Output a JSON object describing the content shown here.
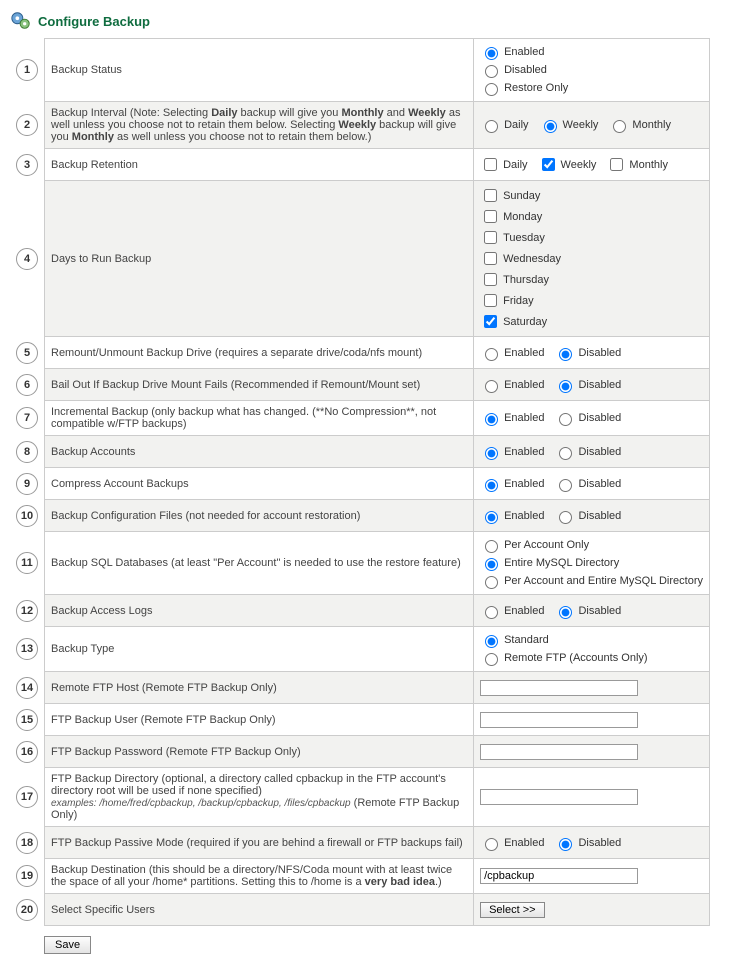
{
  "title": "Configure Backup",
  "save_label": "Save",
  "select_label": "Select >>",
  "rows": [
    {
      "num": "1",
      "label": "Backup Status",
      "type": "radio_col",
      "options": [
        "Enabled",
        "Disabled",
        "Restore Only"
      ],
      "checked": 0
    },
    {
      "num": "2",
      "label": "Backup Interval (Note: Selecting <b>Daily</b> backup will give you <b>Monthly</b> and <b>Weekly</b> as well unless you choose not to retain them below. Selecting <b>Weekly</b> backup will give you <b>Monthly</b> as well unless you choose not to retain them below.)",
      "type": "radio_row",
      "options": [
        "Daily",
        "Weekly",
        "Monthly"
      ],
      "checked": 1
    },
    {
      "num": "3",
      "label": "Backup Retention",
      "type": "check_row",
      "options": [
        "Daily",
        "Weekly",
        "Monthly"
      ],
      "checked": [
        1
      ]
    },
    {
      "num": "4",
      "label": "Days to Run Backup",
      "type": "check_col",
      "options": [
        "Sunday",
        "Monday",
        "Tuesday",
        "Wednesday",
        "Thursday",
        "Friday",
        "Saturday"
      ],
      "checked": [
        6
      ]
    },
    {
      "num": "5",
      "label": "Remount/Unmount Backup Drive (requires a separate drive/coda/nfs mount)",
      "type": "radio_row",
      "options": [
        "Enabled",
        "Disabled"
      ],
      "checked": 1
    },
    {
      "num": "6",
      "label": "Bail Out If Backup Drive Mount Fails (Recommended if Remount/Mount set)",
      "type": "radio_row",
      "options": [
        "Enabled",
        "Disabled"
      ],
      "checked": 1
    },
    {
      "num": "7",
      "label": "Incremental Backup (only backup what has changed. (**No Compression**, not compatible w/FTP backups)",
      "type": "radio_row",
      "options": [
        "Enabled",
        "Disabled"
      ],
      "checked": 0
    },
    {
      "num": "8",
      "label": "Backup Accounts",
      "type": "radio_row",
      "options": [
        "Enabled",
        "Disabled"
      ],
      "checked": 0
    },
    {
      "num": "9",
      "label": "Compress Account Backups",
      "type": "radio_row",
      "options": [
        "Enabled",
        "Disabled"
      ],
      "checked": 0
    },
    {
      "num": "10",
      "label": "Backup Configuration Files (not needed for account restoration)",
      "type": "radio_row",
      "options": [
        "Enabled",
        "Disabled"
      ],
      "checked": 0
    },
    {
      "num": "11",
      "label": "Backup SQL Databases (at least \"Per Account\" is needed to use the restore feature)",
      "type": "radio_col",
      "options": [
        "Per Account Only",
        "Entire MySQL Directory",
        "Per Account and Entire MySQL Directory"
      ],
      "checked": 1
    },
    {
      "num": "12",
      "label": "Backup Access Logs",
      "type": "radio_row",
      "options": [
        "Enabled",
        "Disabled"
      ],
      "checked": 1
    },
    {
      "num": "13",
      "label": "Backup Type",
      "type": "radio_col",
      "options": [
        "Standard",
        "Remote FTP (Accounts Only)"
      ],
      "checked": 0
    },
    {
      "num": "14",
      "label": "Remote FTP Host (Remote FTP Backup Only)",
      "type": "text",
      "value": ""
    },
    {
      "num": "15",
      "label": "FTP Backup User (Remote FTP Backup Only)",
      "type": "text",
      "value": ""
    },
    {
      "num": "16",
      "label": "FTP Backup Password (Remote FTP Backup Only)",
      "type": "text",
      "value": ""
    },
    {
      "num": "17",
      "label": "FTP Backup Directory (optional, a directory called cpbackup in the FTP account's directory root will be used if none specified)<br><span class='note'>examples: /home/fred/cpbackup, /backup/cpbackup, /files/cpbackup</span> (Remote FTP Backup Only)",
      "type": "text",
      "value": ""
    },
    {
      "num": "18",
      "label": "FTP Backup Passive Mode (required if you are behind a firewall or FTP backups fail)",
      "type": "radio_row",
      "options": [
        "Enabled",
        "Disabled"
      ],
      "checked": 1
    },
    {
      "num": "19",
      "label": "Backup Destination (this should be a directory/NFS/Coda mount with at least twice the space of all your /home* partitions. Setting this to /home is a <b>very bad idea</b>.)",
      "type": "text",
      "value": "/cpbackup"
    },
    {
      "num": "20",
      "label": "Select Specific Users",
      "type": "button"
    }
  ]
}
